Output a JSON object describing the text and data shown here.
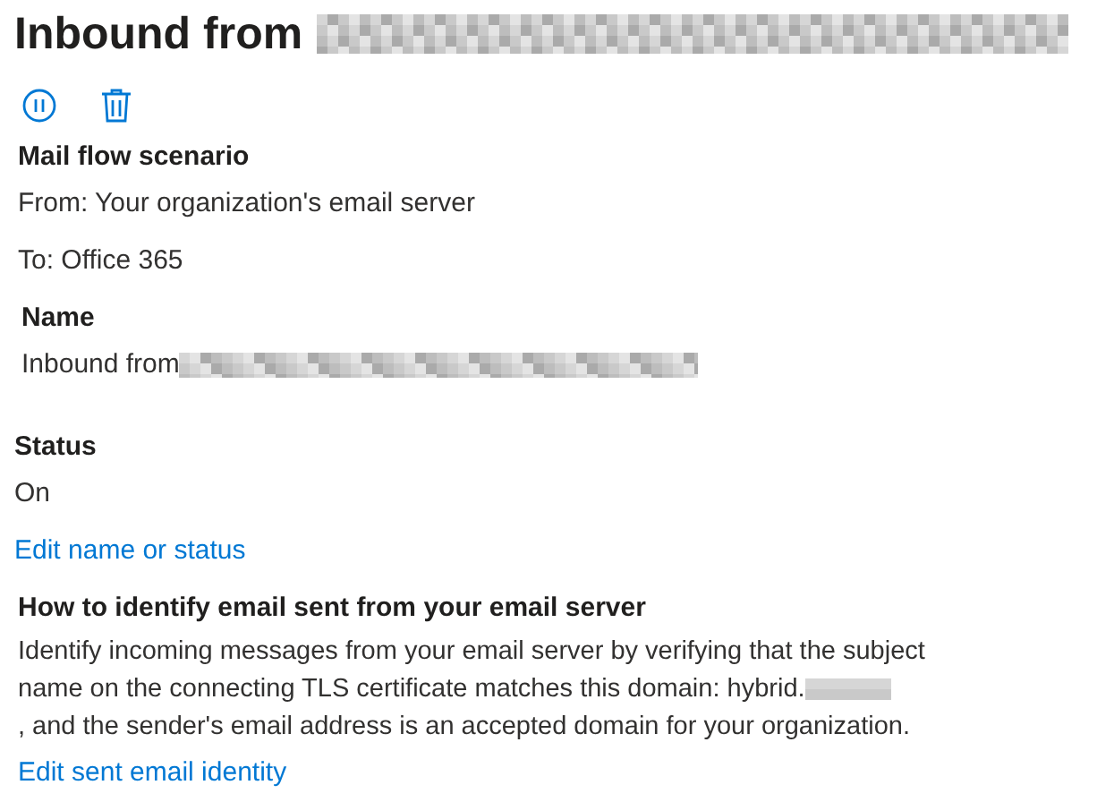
{
  "title": "Inbound from",
  "toolbar": [
    {
      "kind": "pause"
    },
    {
      "kind": "delete"
    }
  ],
  "sections": [
    {
      "heading": "Mail flow scenario",
      "lines": [
        "From: Your organization's email server",
        "To: Office 365"
      ]
    },
    {
      "heading": "Name",
      "lines": [
        "Inbound from"
      ],
      "redacted": true
    },
    {
      "heading": "Status",
      "lines": [
        "On"
      ],
      "link": "Edit name or status"
    },
    {
      "heading": "How to identify email sent from your email server",
      "paragraph": [
        "Identify incoming messages from your email server by verifying that the subject",
        "name on the connecting TLS certificate matches this domain: hybrid.",
        ", and the sender's email address is an accepted domain for your organization."
      ],
      "link": "Edit sent email identity"
    }
  ]
}
